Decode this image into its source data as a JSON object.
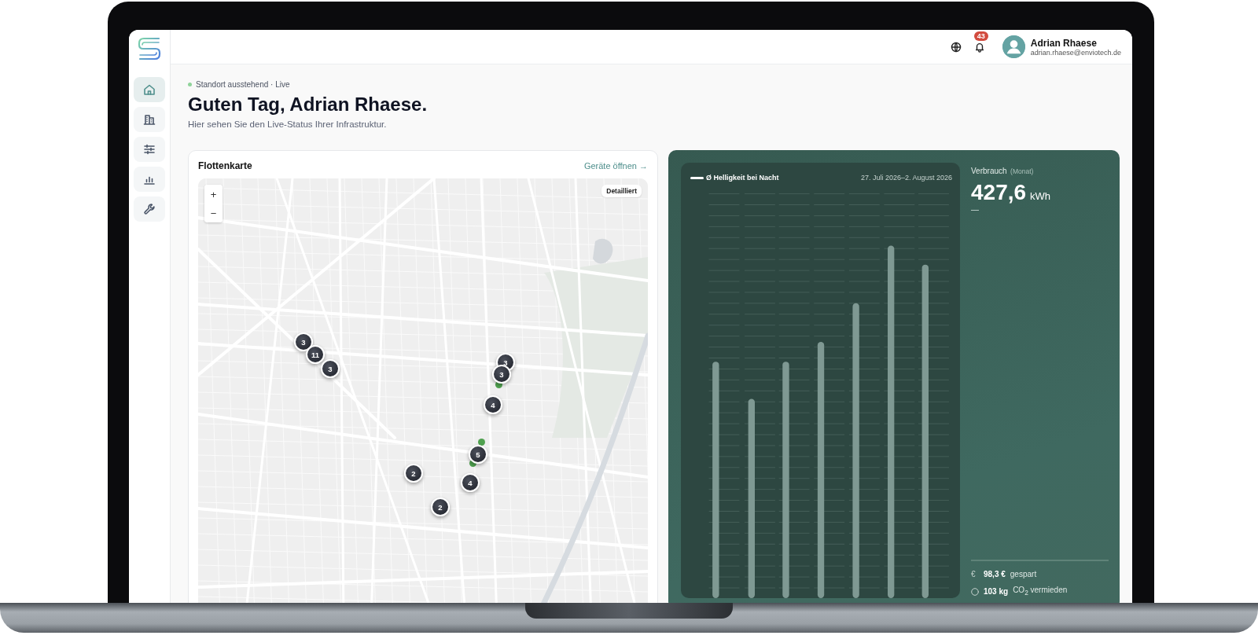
{
  "sidebar": {
    "nav": [
      {
        "selected": true
      },
      {
        "selected": false
      },
      {
        "selected": false
      },
      {
        "selected": false
      },
      {
        "selected": false
      }
    ]
  },
  "header": {
    "notifications": {
      "count": "43"
    },
    "user": {
      "name": "Adrian Rhaese",
      "email": "adrian.rhaese@enviotech.de"
    }
  },
  "page": {
    "status": "Standort ausstehend · Live",
    "title": "Guten Tag, Adrian Rhaese.",
    "subtitle": "Hier sehen Sie den Live-Status Ihrer Infrastruktur."
  },
  "fleet_map": {
    "title": "Flottenkarte",
    "link": "Geräte öffnen →",
    "zoom_in": "+",
    "zoom_out": "−",
    "style_badge": "Detailliert",
    "markers": [
      {
        "kind": "single"
      },
      {
        "kind": "single"
      },
      {
        "kind": "single"
      },
      {
        "kind": "cluster",
        "count": "3"
      },
      {
        "kind": "cluster",
        "count": "11"
      },
      {
        "kind": "cluster",
        "count": "3"
      },
      {
        "kind": "cluster",
        "count": "3"
      },
      {
        "kind": "cluster",
        "count": "3"
      },
      {
        "kind": "cluster",
        "count": "4"
      },
      {
        "kind": "cluster",
        "count": "5"
      },
      {
        "kind": "cluster",
        "count": "4"
      },
      {
        "kind": "cluster",
        "count": "2"
      },
      {
        "kind": "cluster",
        "count": "2"
      }
    ]
  },
  "consumption": {
    "chart": {
      "legend": "Ø Helligkeit bei Nacht",
      "date_range": "27. Juli 2026–2. August 2026"
    },
    "label": "Verbrauch",
    "period": "(Monat)",
    "value": "427,6",
    "unit": "kWh",
    "trend": "—",
    "savings": [
      {
        "symbol": "€",
        "value": "98,3 €",
        "label": "gespart"
      },
      {
        "value": "103 kg",
        "label": "CO$_{2}$ vermieden"
      }
    ]
  }
}
